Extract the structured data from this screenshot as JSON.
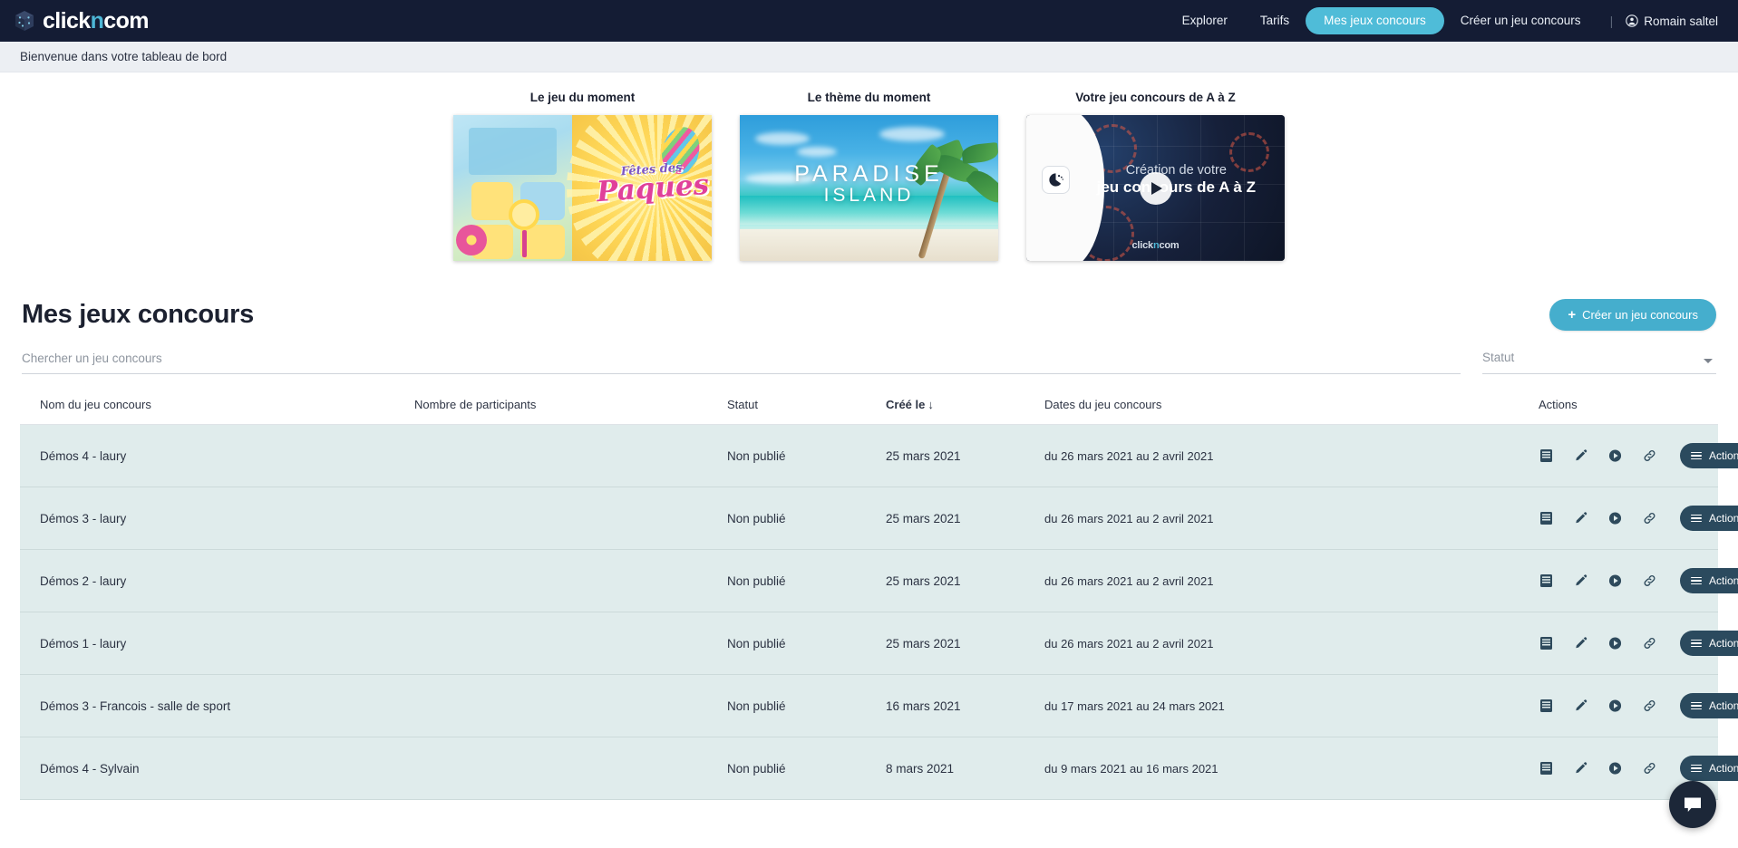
{
  "brand": {
    "text_click": "click",
    "text_n": "n",
    "text_com": "com",
    "cube_icon": "cube-logo-icon"
  },
  "topnav": {
    "links": [
      {
        "label": "Explorer",
        "active": false
      },
      {
        "label": "Tarifs",
        "active": false
      },
      {
        "label": "Mes jeux concours",
        "active": true
      },
      {
        "label": "Créer un jeu concours",
        "active": false
      }
    ],
    "separator": "|",
    "user": {
      "name": "Romain saltel",
      "icon": "user-circle-icon"
    },
    "active_color": "#4fbcd8",
    "bg_color": "#141c34"
  },
  "welcome": {
    "text": "Bienvenue dans votre tableau de bord"
  },
  "promos": [
    {
      "title": "Le jeu du moment",
      "id": "promo-easter",
      "art_word": "Paques",
      "art_sub": "Fêtes des"
    },
    {
      "title": "Le thème du moment",
      "id": "promo-paradise",
      "line1": "PARADISE",
      "line2": "ISLAND"
    },
    {
      "title": "Votre jeu concours de A à Z",
      "id": "promo-video",
      "line1": "Création de votre",
      "line2": "jeu concours de A à Z",
      "logo_click": "click",
      "logo_n": "n",
      "logo_com": "com",
      "play_icon": "play-icon"
    }
  ],
  "page": {
    "title": "Mes jeux concours",
    "create_button": {
      "label": "Créer un jeu concours",
      "plus": "+",
      "color": "#45aecd"
    }
  },
  "filters": {
    "search": {
      "placeholder": "Chercher un jeu concours",
      "value": ""
    },
    "status": {
      "label": "Statut",
      "value": "",
      "caret_icon": "chevron-down-icon"
    }
  },
  "table": {
    "columns": [
      "Nom du jeu concours",
      "Nombre de participants",
      "Statut",
      "Créé le",
      "Dates du jeu concours",
      "Actions"
    ],
    "sort_column": "Créé le",
    "sort_arrow": "↓",
    "row_bg": "#e0ecec",
    "action_icons": [
      "book-icon",
      "pencil-icon",
      "play-circle-icon",
      "link-icon"
    ],
    "actions_button_label": "Actions",
    "rows": [
      {
        "name": "Démos 4 - laury",
        "participants": "",
        "statut": "Non publié",
        "created": "25 mars 2021",
        "dates": "du 26 mars 2021 au 2 avril 2021"
      },
      {
        "name": "Démos 3 - laury",
        "participants": "",
        "statut": "Non publié",
        "created": "25 mars 2021",
        "dates": "du 26 mars 2021 au 2 avril 2021"
      },
      {
        "name": "Démos 2 - laury",
        "participants": "",
        "statut": "Non publié",
        "created": "25 mars 2021",
        "dates": "du 26 mars 2021 au 2 avril 2021"
      },
      {
        "name": "Démos 1 - laury",
        "participants": "",
        "statut": "Non publié",
        "created": "25 mars 2021",
        "dates": "du 26 mars 2021 au 2 avril 2021"
      },
      {
        "name": "Démos 3 - Francois - salle de sport",
        "participants": "",
        "statut": "Non publié",
        "created": "16 mars 2021",
        "dates": "du 17 mars 2021 au 24 mars 2021"
      },
      {
        "name": "Démos 4 - Sylvain",
        "participants": "",
        "statut": "Non publié",
        "created": "8 mars 2021",
        "dates": "du 9 mars 2021 au 16 mars 2021"
      }
    ]
  },
  "chat": {
    "icon": "chat-bubble-icon"
  }
}
